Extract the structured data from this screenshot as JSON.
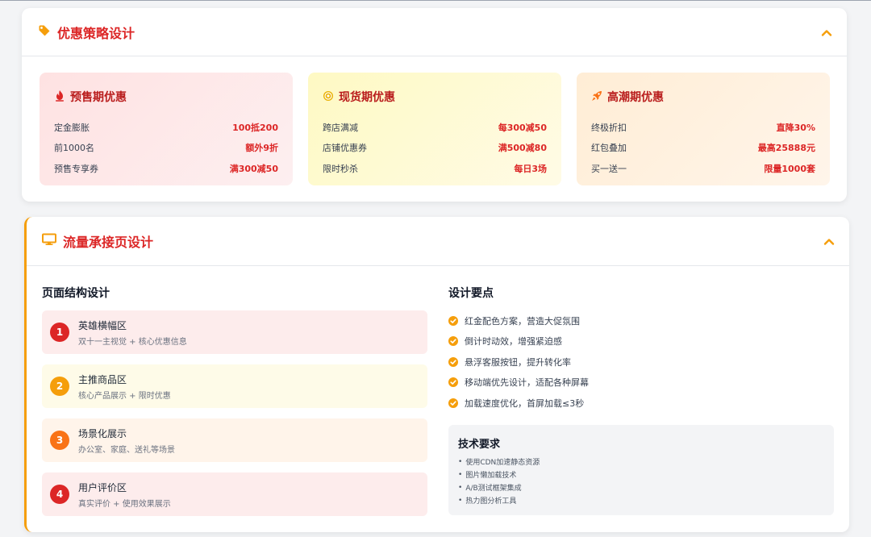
{
  "strategy": {
    "title": "优惠策略设计",
    "cards": [
      {
        "title": "预售期优惠",
        "icon": "fire-icon",
        "items": [
          {
            "label": "定金膨胀",
            "value": "100抵200"
          },
          {
            "label": "前1000名",
            "value": "额外9折"
          },
          {
            "label": "预售专享券",
            "value": "满300减50"
          }
        ]
      },
      {
        "title": "现货期优惠",
        "icon": "coin-icon",
        "items": [
          {
            "label": "跨店满减",
            "value": "每300减50"
          },
          {
            "label": "店铺优惠券",
            "value": "满500减80"
          },
          {
            "label": "限时秒杀",
            "value": "每日3场"
          }
        ]
      },
      {
        "title": "高潮期优惠",
        "icon": "rocket-icon",
        "items": [
          {
            "label": "终极折扣",
            "value": "直降30%"
          },
          {
            "label": "红包叠加",
            "value": "最高25888元"
          },
          {
            "label": "买一送一",
            "value": "限量1000套"
          }
        ]
      }
    ]
  },
  "landing": {
    "title": "流量承接页设计",
    "structure_title": "页面结构设计",
    "sections": [
      {
        "num": "1",
        "name": "英雄横幅区",
        "desc": "双十一主视觉 + 核心优惠信息"
      },
      {
        "num": "2",
        "name": "主推商品区",
        "desc": "核心产品展示 + 限时优惠"
      },
      {
        "num": "3",
        "name": "场景化展示",
        "desc": "办公室、家庭、送礼等场景"
      },
      {
        "num": "4",
        "name": "用户评价区",
        "desc": "真实评价 + 使用效果展示"
      }
    ],
    "points_title": "设计要点",
    "points": [
      "红金配色方案，营造大促氛围",
      "倒计时动效，增强紧迫感",
      "悬浮客服按钮，提升转化率",
      "移动端优先设计，适配各种屏幕",
      "加载速度优化，首屏加载≤3秒"
    ],
    "tech_title": "技术要求",
    "tech_items": [
      "使用CDN加速静态资源",
      "图片懒加载技术",
      "A/B测试框架集成",
      "热力图分析工具"
    ]
  },
  "colors": {
    "accent_red": "#dc2626",
    "accent_amber": "#f59e0b",
    "accent_orange": "#f97316"
  }
}
